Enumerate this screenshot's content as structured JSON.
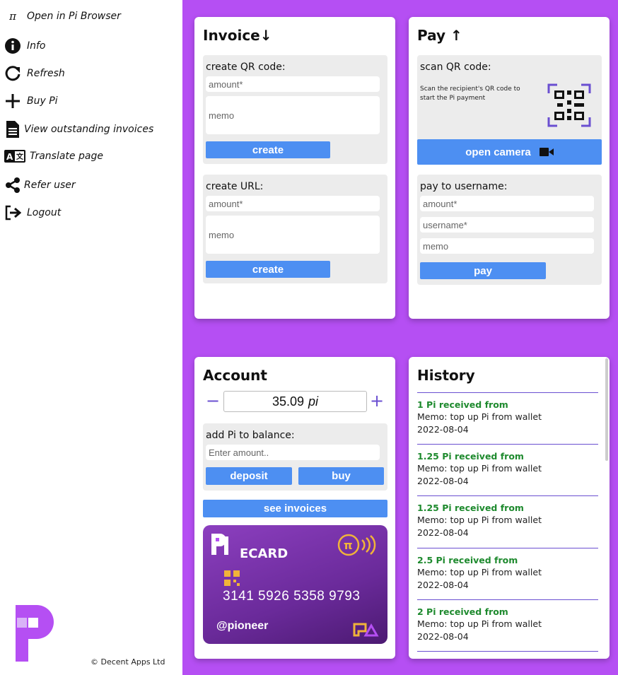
{
  "sidebar": {
    "items": [
      {
        "label": "Open in Pi Browser",
        "icon": "pi-icon"
      },
      {
        "label": "Info",
        "icon": "info-icon"
      },
      {
        "label": "Refresh",
        "icon": "refresh-icon"
      },
      {
        "label": "Buy Pi",
        "icon": "plus-icon"
      },
      {
        "label": "View outstanding invoices",
        "icon": "document-icon"
      },
      {
        "label": "Translate page",
        "icon": "translate-icon"
      },
      {
        "label": "Refer user",
        "icon": "share-icon"
      },
      {
        "label": "Logout",
        "icon": "logout-icon"
      }
    ],
    "copyright": "© Decent Apps Ltd"
  },
  "colors": {
    "background": "#b54ff3",
    "button": "#4d8ff2",
    "history_green": "#1e8a2e",
    "accent": "#6a4fd1"
  },
  "invoice": {
    "title": "Invoice↓",
    "qr_section": {
      "label": "create QR code:",
      "amount_placeholder": "amount*",
      "memo_placeholder": "memo",
      "button": "create"
    },
    "url_section": {
      "label": "create URL:",
      "amount_placeholder": "amount*",
      "memo_placeholder": "memo",
      "button": "create"
    }
  },
  "pay": {
    "title": "Pay ↑",
    "scan_section": {
      "label": "scan QR code:",
      "description": "Scan the recipient's QR code to start the Pi payment",
      "button": "open camera"
    },
    "username_section": {
      "label": "pay to username:",
      "amount_placeholder": "amount*",
      "username_placeholder": "username*",
      "memo_placeholder": "memo",
      "button": "pay"
    }
  },
  "account": {
    "title": "Account",
    "balance": "35.09",
    "unit": "pi",
    "minus": "−",
    "plus": "+",
    "add_section": {
      "label": "add Pi to balance:",
      "amount_placeholder": "Enter amount..",
      "deposit_button": "deposit",
      "buy_button": "buy"
    },
    "see_invoices_button": "see invoices",
    "ecard": {
      "brand": "ECARD",
      "number": "3141 5926 5358 9793",
      "username": "@pioneer"
    }
  },
  "history": {
    "title": "History",
    "items": [
      {
        "title": "1 Pi received from",
        "memo": "Memo: top up Pi from wallet",
        "date": "2022-08-04"
      },
      {
        "title": "1.25 Pi received from",
        "memo": "Memo: top up Pi from wallet",
        "date": "2022-08-04"
      },
      {
        "title": "1.25 Pi received from",
        "memo": "Memo: top up Pi from wallet",
        "date": "2022-08-04"
      },
      {
        "title": "2.5 Pi received from",
        "memo": "Memo: top up Pi from wallet",
        "date": "2022-08-04"
      },
      {
        "title": "2 Pi received from",
        "memo": "Memo: top up Pi from wallet",
        "date": "2022-08-04"
      }
    ]
  }
}
